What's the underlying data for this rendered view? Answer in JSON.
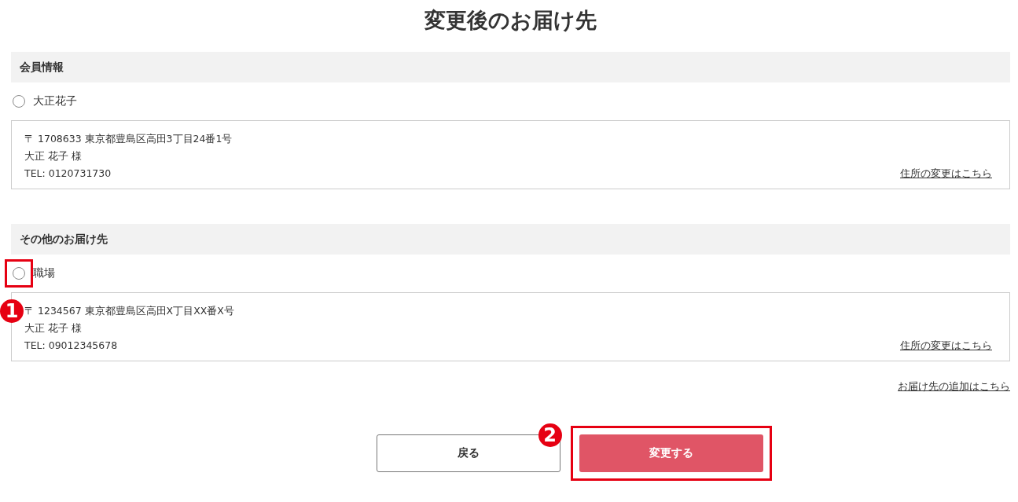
{
  "title": "変更後のお届け先",
  "sections": [
    {
      "heading": "会員情報",
      "entries": [
        {
          "name": "大正花子",
          "selected": false,
          "address": "〒 1708633 東京都豊島区高田3丁目24番1号",
          "recipient": "大正 花子 様",
          "tel": "TEL: 0120731730",
          "change_link": "住所の変更はこちら"
        }
      ]
    },
    {
      "heading": "その他のお届け先",
      "entries": [
        {
          "name": "職場",
          "selected": false,
          "highlighted": true,
          "badge": "1",
          "address": "〒 1234567 東京都豊島区高田X丁目XX番X号",
          "recipient": "大正 花子 様",
          "tel": "TEL: 09012345678",
          "change_link": "住所の変更はこちら"
        }
      ]
    }
  ],
  "add_link": "お届け先の追加はこちら",
  "buttons": [
    {
      "label": "戻る",
      "kind": "secondary"
    },
    {
      "label": "変更する",
      "kind": "primary",
      "highlighted": true,
      "badge": "2"
    }
  ]
}
